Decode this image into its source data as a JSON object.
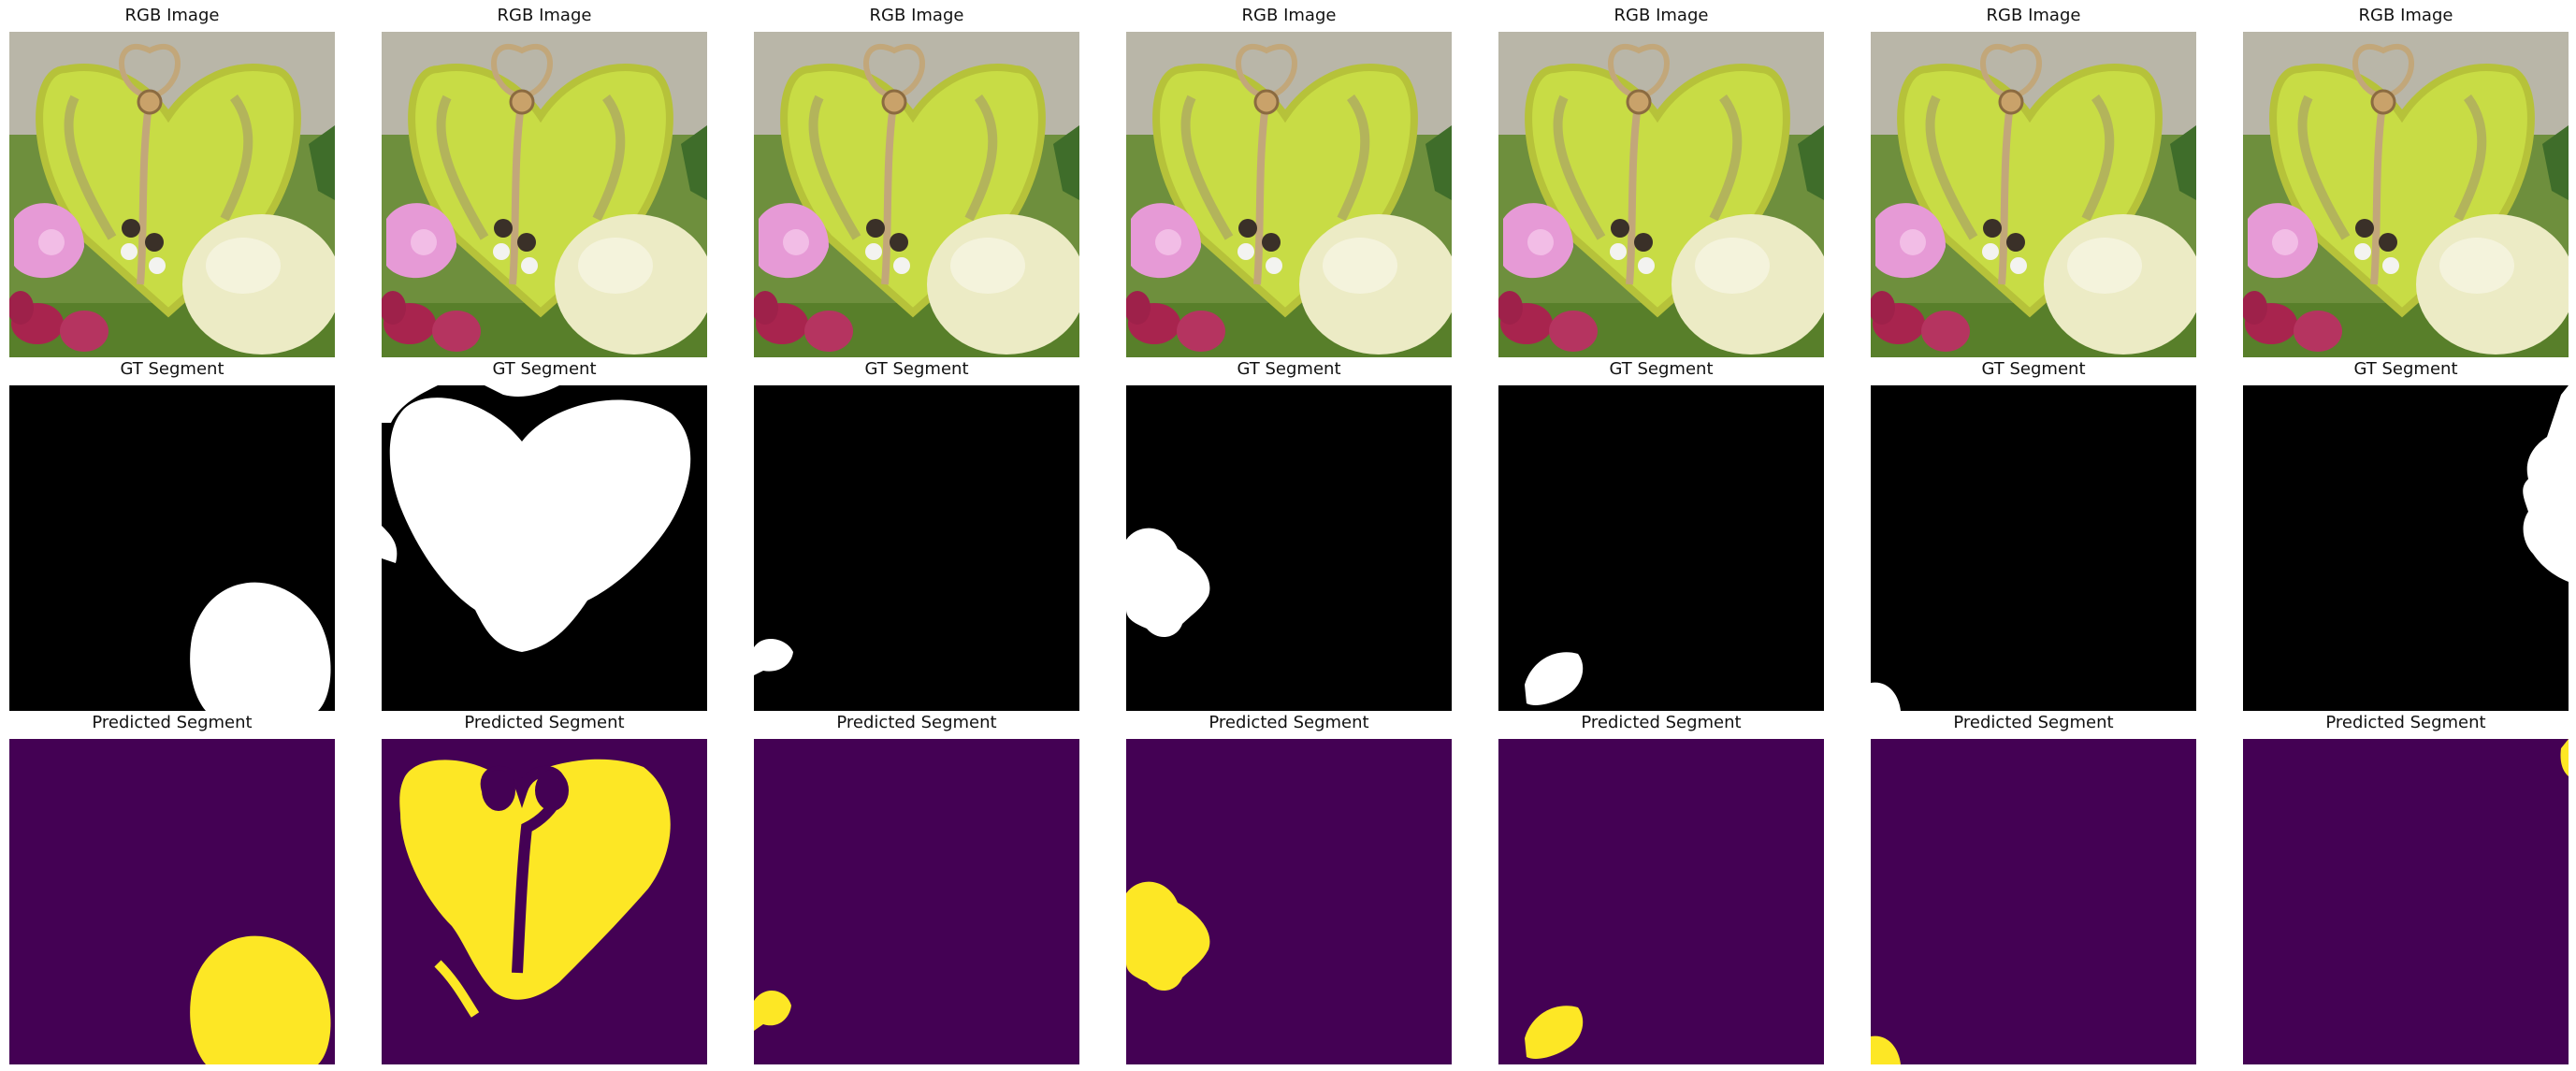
{
  "rows": [
    {
      "key": "rgb",
      "title": "RGB Image",
      "columns": [
        "rgb-image",
        "rgb-image",
        "rgb-image",
        "rgb-image",
        "rgb-image",
        "rgb-image",
        "rgb-image"
      ]
    },
    {
      "key": "gt",
      "title": "GT Segment",
      "columns": [
        "egg",
        "heart",
        "small-pink-blob",
        "flower-left",
        "egg-left",
        "tiny-bottom-left",
        "foliage-right"
      ]
    },
    {
      "key": "pred",
      "title": "Predicted Segment",
      "columns": [
        "egg",
        "heart-with-rope-gaps",
        "small-blob",
        "flower-left",
        "egg-left",
        "tiny-bottom-left",
        "foliage-right"
      ]
    }
  ],
  "colors": {
    "gt_background": "#000000",
    "gt_foreground": "#ffffff",
    "pred_background": "#440154",
    "pred_foreground": "#fde725",
    "rgb_heart": "#c8dc45",
    "rgb_bg": "#8aa24a"
  }
}
